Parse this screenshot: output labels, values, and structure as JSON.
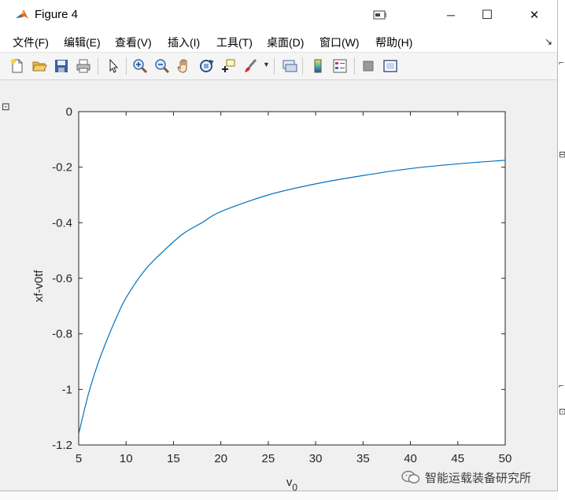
{
  "window": {
    "title": "Figure 4",
    "controls": {
      "minimize": "─",
      "maximize": "☐",
      "close": "✕"
    }
  },
  "menu": {
    "items": [
      "文件(F)",
      "编辑(E)",
      "查看(V)",
      "插入(I)",
      "工具(T)",
      "桌面(D)",
      "窗口(W)",
      "帮助(H)"
    ]
  },
  "toolbar": {
    "buttons": [
      "new-figure-icon",
      "open-file-icon",
      "save-icon",
      "print-icon",
      "pointer-icon",
      "zoom-in-icon",
      "zoom-out-icon",
      "pan-hand-icon",
      "rotate-3d-icon",
      "data-cursor-icon",
      "brush-icon",
      "dropdown-arrow-icon",
      "link-plot-icon",
      "colorbar-icon",
      "legend-icon",
      "hide-plot-tools-icon",
      "show-plot-tools-icon"
    ]
  },
  "chart_data": {
    "type": "line",
    "title": "",
    "xlabel": "v",
    "xlabel_subscript": "0",
    "ylabel": "xf-v0tf",
    "xlim": [
      5,
      50
    ],
    "ylim": [
      -1.2,
      0
    ],
    "xticks": [
      "5",
      "10",
      "15",
      "20",
      "25",
      "30",
      "35",
      "40",
      "45",
      "50"
    ],
    "yticks": [
      "0",
      "-0.2",
      "-0.4",
      "-0.6",
      "-0.8",
      "-1",
      "-1.2"
    ],
    "grid": false,
    "line_color": "#0072bd",
    "series": [
      {
        "x": [
          5,
          6,
          7,
          8,
          9,
          10,
          12,
          14,
          16,
          18,
          20,
          25,
          30,
          35,
          40,
          45,
          50
        ],
        "y": [
          -1.16,
          -1.02,
          -0.91,
          -0.82,
          -0.74,
          -0.67,
          -0.57,
          -0.5,
          -0.44,
          -0.4,
          -0.36,
          -0.3,
          -0.26,
          -0.23,
          -0.205,
          -0.188,
          -0.175
        ]
      }
    ]
  },
  "watermark": {
    "text": "智能运载装备研究所"
  }
}
